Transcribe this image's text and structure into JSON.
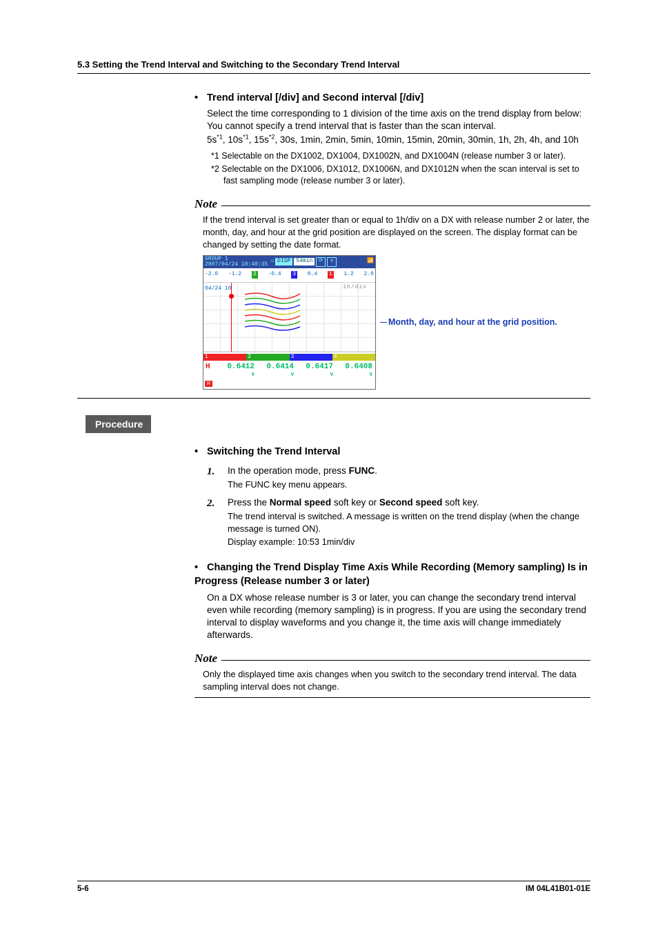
{
  "header": {
    "section": "5.3  Setting the Trend Interval and Switching to the Secondary Trend Interval"
  },
  "trend_interval": {
    "heading": "Trend interval [/div] and Second interval [/div]",
    "body1": "Select the time corresponding to 1 division of the time axis on the trend display from below: You cannot specify a trend interval that is faster than the scan interval.",
    "body2_pre": "5s",
    "body2_mid1": ", 10s",
    "body2_mid2": ", 15s",
    "body2_post": ", 30s, 1min, 2min, 5min, 10min, 15min, 20min, 30min, 1h, 2h, 4h, and 10h",
    "fn1": "*1  Selectable on the DX1002, DX1004, DX1002N, and DX1004N (release number 3 or later).",
    "fn2": "*2  Selectable on the DX1006, DX1012, DX1006N, and DX1012N when the scan interval is set to fast sampling mode (release number 3 or later)."
  },
  "note1": {
    "label": "Note",
    "body": "If the trend interval is set greater than or equal to 1h/div on a DX with release number 2 or later, the month, day, and hour at the grid position are displayed on the screen. The display format can be changed by setting the date format."
  },
  "screenshot": {
    "group": "GROUP 1",
    "timestamp": "2007/04/24 10:40:35",
    "disp": "DISP",
    "span": "54min",
    "scale": [
      "-2.0",
      "-1.2",
      "-0.4",
      "0.4",
      "1.2",
      "2.0"
    ],
    "datelabel": "04/24 10",
    "hdiv": "1h/div",
    "ch_labels": [
      "1",
      "2",
      "3",
      "4"
    ],
    "values": [
      "0.6412",
      "0.6414",
      "0.6417",
      "0.6408"
    ],
    "h": "H",
    "unit": "V",
    "callout": "Month, day, and hour at the grid position."
  },
  "procedure": {
    "label": "Procedure",
    "switch_heading": "Switching the Trend Interval",
    "step1_pre": "In the operation mode, press ",
    "step1_bold": "FUNC",
    "step1_post": ".",
    "step1_sub": "The FUNC key menu appears.",
    "step2_pre": "Press the ",
    "step2_b1": "Normal speed",
    "step2_mid": " soft key or ",
    "step2_b2": "Second speed",
    "step2_post": " soft key.",
    "step2_sub1": "The trend interval is switched. A message is written on the trend display (when the change message is turned ON).",
    "step2_sub2": "Display example: 10:53 1min/div",
    "change_heading": "Changing the Trend Display Time Axis While Recording (Memory sampling) Is in Progress (Release number 3 or later)",
    "change_body": "On a DX whose release number is 3 or later, you can change the secondary trend interval even while recording (memory sampling) is in progress. If you are using the secondary trend interval to display waveforms and you change it, the time axis will change immediately afterwards."
  },
  "note2": {
    "label": "Note",
    "body": "Only the displayed time axis changes when you switch to the secondary trend interval. The data sampling interval does not change."
  },
  "footer": {
    "page": "5-6",
    "doc": "IM 04L41B01-01E"
  }
}
